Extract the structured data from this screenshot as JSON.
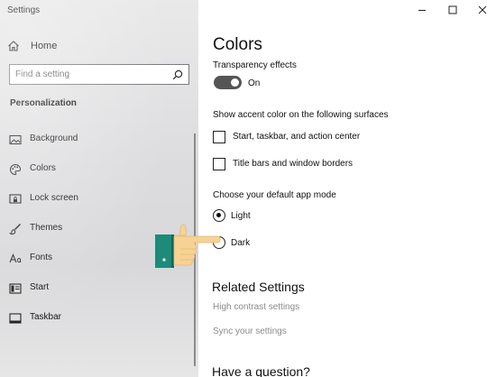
{
  "window": {
    "title": "Settings"
  },
  "sidebar": {
    "home_label": "Home",
    "search_placeholder": "Find a setting",
    "section_title": "Personalization",
    "items": [
      {
        "label": "Background",
        "icon": "image-icon"
      },
      {
        "label": "Colors",
        "icon": "palette-icon"
      },
      {
        "label": "Lock screen",
        "icon": "lock-screen-icon"
      },
      {
        "label": "Themes",
        "icon": "brush-icon"
      },
      {
        "label": "Fonts",
        "icon": "font-icon"
      },
      {
        "label": "Start",
        "icon": "start-icon"
      },
      {
        "label": "Taskbar",
        "icon": "taskbar-icon"
      }
    ]
  },
  "main": {
    "title": "Colors",
    "transparency": {
      "label": "Transparency effects",
      "state": "On",
      "on": true
    },
    "accent": {
      "label": "Show accent color on the following surfaces",
      "options": [
        {
          "label": "Start, taskbar, and action center",
          "checked": false
        },
        {
          "label": "Title bars and window borders",
          "checked": false
        }
      ]
    },
    "app_mode": {
      "label": "Choose your default app mode",
      "options": [
        {
          "label": "Light",
          "checked": true
        },
        {
          "label": "Dark",
          "checked": false
        }
      ]
    },
    "related": {
      "title": "Related Settings",
      "links": [
        "High contrast settings",
        "Sync your settings"
      ]
    },
    "question_title": "Have a question?"
  },
  "colors": {
    "toggle_on": "#555555",
    "link": "#8a8a8a",
    "hand_cuff": "#1e8a7a",
    "hand_skin": "#f6d294"
  }
}
